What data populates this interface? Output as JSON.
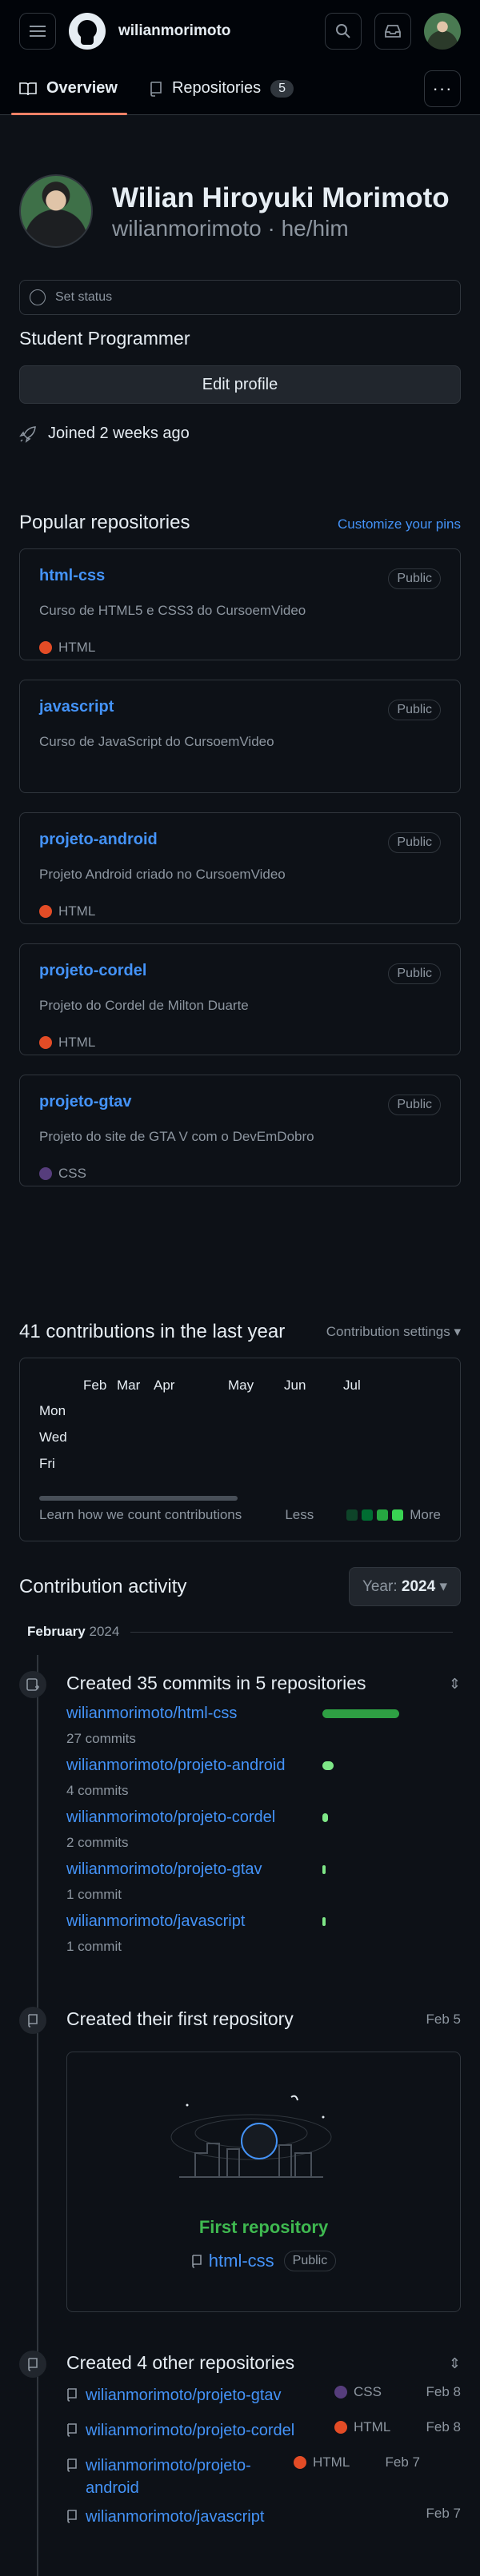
{
  "header": {
    "username": "wilianmorimoto"
  },
  "tabs": [
    {
      "label": "Overview"
    },
    {
      "label": "Repositories",
      "count": "5"
    }
  ],
  "profile": {
    "name": "Wilian Hiroyuki Morimoto",
    "login_pronouns": "wilianmorimoto · he/him",
    "status": "Set status",
    "bio": "Student Programmer",
    "edit": "Edit profile",
    "joined": "Joined 2 weeks ago"
  },
  "popular": {
    "title": "Popular repositories",
    "customize": "Customize your pins",
    "repos": [
      {
        "name": "html-css",
        "visibility": "Public",
        "desc": "Curso de HTML5 e CSS3 do CursoemVideo",
        "lang": "HTML",
        "color": "#e34c26"
      },
      {
        "name": "javascript",
        "visibility": "Public",
        "desc": "Curso de JavaScript do CursoemVideo",
        "lang": "",
        "color": ""
      },
      {
        "name": "projeto-android",
        "visibility": "Public",
        "desc": "Projeto Android criado no CursoemVideo",
        "lang": "HTML",
        "color": "#e34c26"
      },
      {
        "name": "projeto-cordel",
        "visibility": "Public",
        "desc": "Projeto do Cordel de Milton Duarte",
        "lang": "HTML",
        "color": "#e34c26"
      },
      {
        "name": "projeto-gtav",
        "visibility": "Public",
        "desc": "Projeto do site de GTA V com o DevEmDobro",
        "lang": "CSS",
        "color": "#563d7c"
      }
    ]
  },
  "contributions": {
    "title": "41 contributions in the last year",
    "settings": "Contribution settings ▾",
    "months": [
      "Feb",
      "Mar",
      "Apr",
      "May",
      "Jun",
      "Jul"
    ],
    "days": [
      "Mon",
      "Wed",
      "Fri"
    ],
    "learn": "Learn how we count contributions",
    "less": "Less",
    "more": "More",
    "legend_colors": [
      "#0e4429",
      "#006d32",
      "#26a641",
      "#39d353"
    ]
  },
  "activity": {
    "title": "Contribution activity",
    "year_label": "Year:",
    "year": "2024",
    "month": "February",
    "month_year": "2024",
    "commits": {
      "title": "Created 35 commits in 5 repositories",
      "rows": [
        {
          "repo": "wilianmorimoto/html-css",
          "count": "27 commits",
          "value": 27
        },
        {
          "repo": "wilianmorimoto/projeto-android",
          "count": "4 commits",
          "value": 4
        },
        {
          "repo": "wilianmorimoto/projeto-cordel",
          "count": "2 commits",
          "value": 2
        },
        {
          "repo": "wilianmorimoto/projeto-gtav",
          "count": "1 commit",
          "value": 1
        },
        {
          "repo": "wilianmorimoto/javascript",
          "count": "1 commit",
          "value": 1
        }
      ]
    },
    "first": {
      "title": "Created their first repository",
      "date": "Feb 5",
      "label": "First repository",
      "repo": "html-css",
      "visibility": "Public"
    },
    "others": {
      "title": "Created 4 other repositories",
      "rows": [
        {
          "repo": "wilianmorimoto/projeto-gtav",
          "lang": "CSS",
          "color": "#563d7c",
          "date": "Feb 8"
        },
        {
          "repo": "wilianmorimoto/projeto-cordel",
          "lang": "HTML",
          "color": "#e34c26",
          "date": "Feb 8"
        },
        {
          "repo": "wilianmorimoto/projeto-android",
          "lang": "HTML",
          "color": "#e34c26",
          "date": "Feb 7"
        },
        {
          "repo": "wilianmorimoto/javascript",
          "lang": "",
          "color": "",
          "date": "Feb 7"
        }
      ]
    }
  }
}
